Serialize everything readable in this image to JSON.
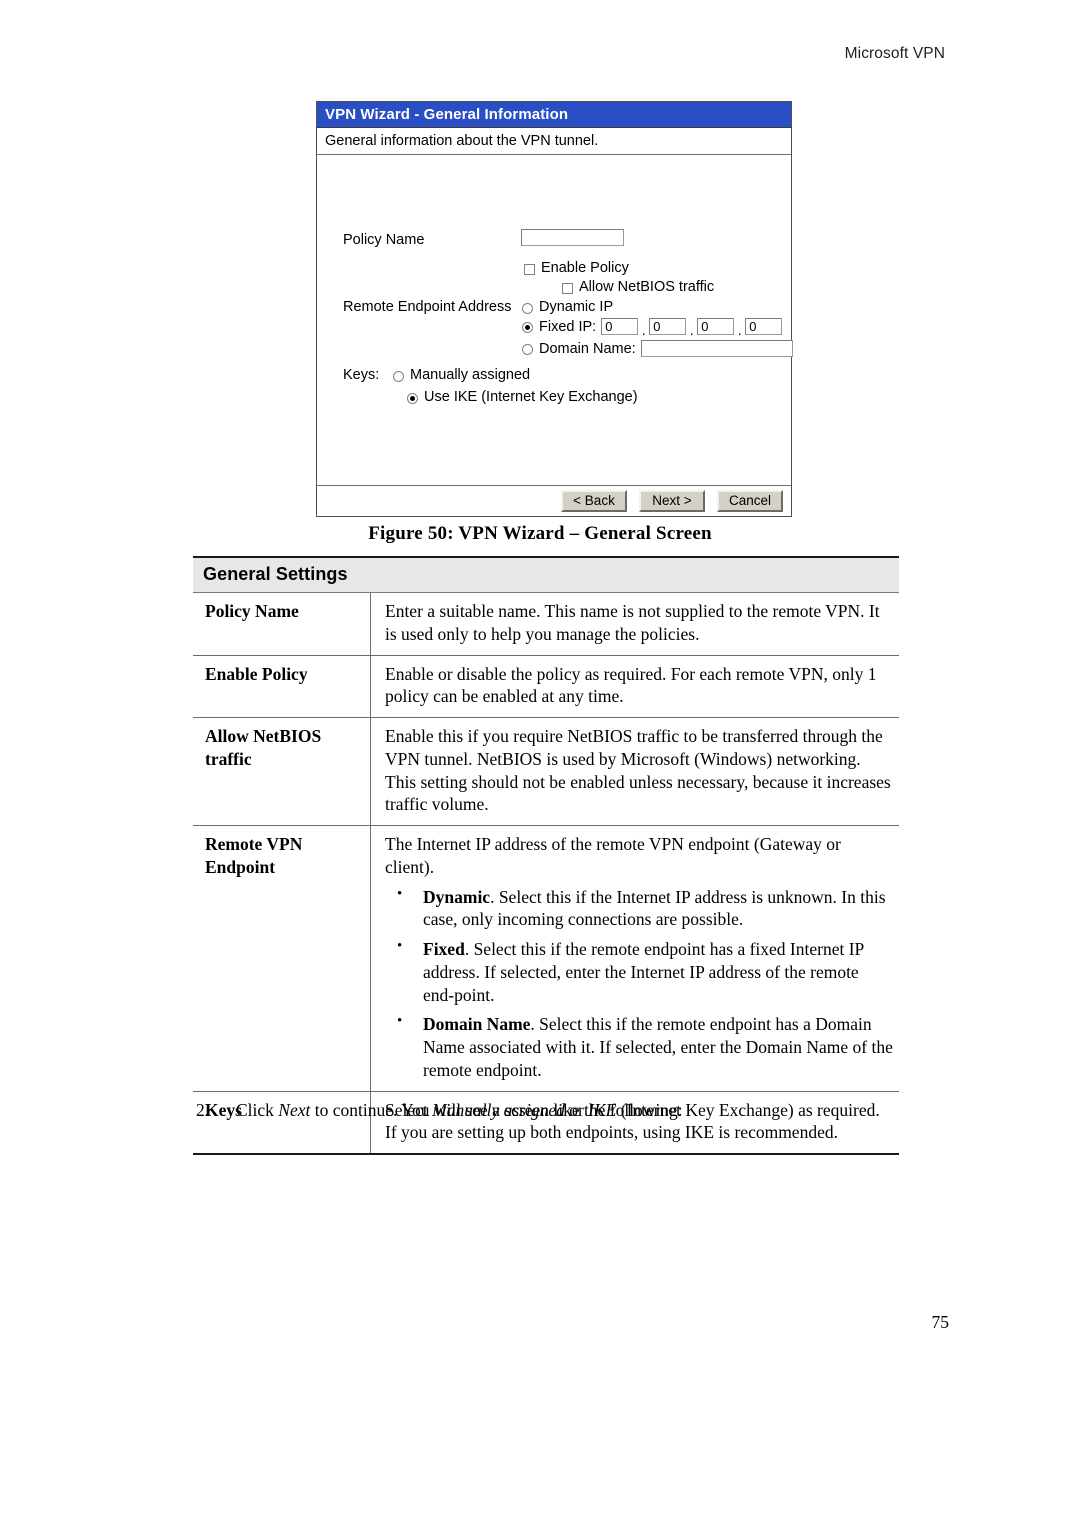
{
  "header": {
    "running_head": "Microsoft VPN"
  },
  "dialog": {
    "title": "VPN Wizard - General Information",
    "subtitle": "General information about the VPN tunnel.",
    "fields": {
      "policy_name_label": "Policy Name",
      "policy_name_value": "",
      "policy_name_placeholder": "",
      "enable_policy_label": "Enable Policy",
      "enable_policy_checked": false,
      "allow_netbios_label": "Allow NetBIOS traffic",
      "allow_netbios_checked": false,
      "remote_endpoint_label": "Remote Endpoint Address",
      "dynamic_ip_label": "Dynamic IP",
      "fixed_ip_label": "Fixed IP:",
      "fixed_ip_octets": [
        "0",
        "0",
        "0",
        "0"
      ],
      "ip_separator": ".",
      "domain_name_label": "Domain Name:",
      "domain_name_value": "",
      "endpoint_selected": "Fixed IP",
      "keys_label": "Keys:",
      "keys_manual_label": "Manually assigned",
      "keys_ike_label": "Use IKE (Internet Key Exchange)",
      "keys_selected": "Use IKE (Internet Key Exchange)"
    },
    "buttons": {
      "back": "< Back",
      "next": "Next >",
      "cancel": "Cancel"
    },
    "colors": {
      "titlebar": "#2a4fc4",
      "titlebar_text": "#ffffff",
      "button_face": "#d4d0c8"
    }
  },
  "figure": {
    "caption": "Figure 50: VPN Wizard – General Screen"
  },
  "table": {
    "header": "General Settings",
    "rows": [
      {
        "key": "Policy Name",
        "text": "Enter a suitable name. This name is not supplied to the remote VPN. It is used only to help you manage the policies."
      },
      {
        "key": "Enable Policy",
        "text": "Enable or disable the policy as required. For each remote VPN, only 1 policy can be enabled at any time."
      },
      {
        "key": "Allow NetBIOS traffic",
        "text": "Enable this if you require NetBIOS traffic to be transferred through the VPN tunnel. NetBIOS is used by Microsoft (Windows) networking. This setting should not be enabled unless necessary, because it increases traffic volume."
      },
      {
        "key": "Remote VPN Endpoint",
        "text": "The Internet IP address of the remote VPN endpoint (Gateway or client).",
        "bullets": [
          {
            "lead": "Dynamic",
            "rest": ". Select this if the Internet IP address is unknown. In this case, only incoming connections are possible."
          },
          {
            "lead": "Fixed",
            "rest": ". Select this if the remote endpoint has a fixed Internet IP address. If selected, enter the Internet IP address of the remote end-point."
          },
          {
            "lead": "Domain Name",
            "rest": ". Select this if the remote endpoint has a Domain Name associated with it. If selected, enter the Domain Name of the remote endpoint."
          }
        ]
      },
      {
        "key": "Keys",
        "text_part1": "Select ",
        "text_italic1": "Manually assigned",
        "text_part2": " or ",
        "text_italic2": "IKE",
        "text_part3": " (Internet Key Exchange) as required. If you are setting up both endpoints, using IKE is recommended."
      }
    ]
  },
  "step": {
    "number": "2.",
    "text_part1": "Click ",
    "text_italic": "Next",
    "text_part2": " to continue. You will see a screen like the following:"
  },
  "footer": {
    "page_number": "75"
  }
}
